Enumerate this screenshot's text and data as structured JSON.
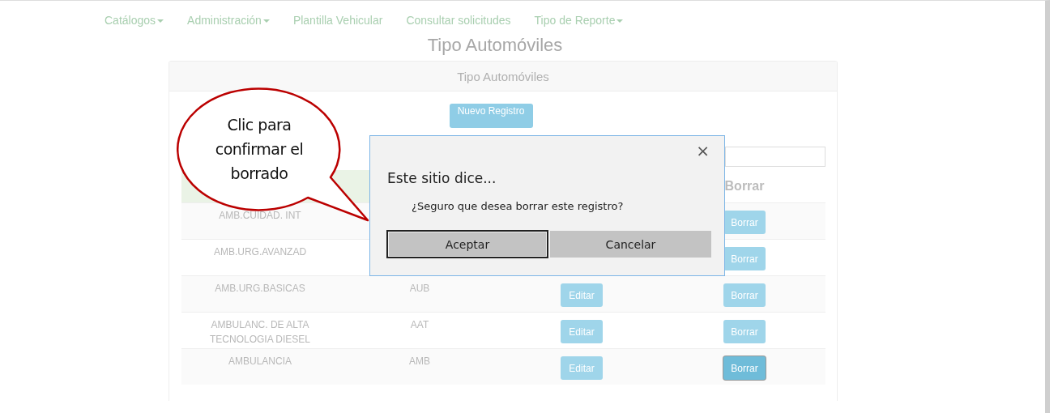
{
  "nav": [
    {
      "label": "Catálogos",
      "dropdown": true
    },
    {
      "label": "Administración",
      "dropdown": true
    },
    {
      "label": "Plantilla Vehicular",
      "dropdown": false
    },
    {
      "label": "Consultar solicitudes",
      "dropdown": false
    },
    {
      "label": "Tipo de Reporte",
      "dropdown": true
    }
  ],
  "page_title": "Tipo Automóviles",
  "panel": {
    "title": "Tipo Automóviles",
    "new_button": "Nuevo Registro",
    "table": {
      "columns": [
        "",
        "",
        "",
        "Borrar"
      ],
      "rows": [
        {
          "description": "AMB.CUIDAD. INT",
          "code": "",
          "edit": "",
          "delete": "Borrar",
          "delete_focused": false
        },
        {
          "description": "AMB.URG.AVANZAD",
          "code": "",
          "edit": "",
          "delete": "Borrar",
          "delete_focused": false
        },
        {
          "description": "AMB.URG.BASICAS",
          "code": "AUB",
          "edit": "Editar",
          "delete": "Borrar",
          "delete_focused": false
        },
        {
          "description": "AMBULANC. DE ALTA TECNOLOGIA DIESEL",
          "code": "AAT",
          "edit": "Editar",
          "delete": "Borrar",
          "delete_focused": false
        },
        {
          "description": "AMBULANCIA",
          "code": "AMB",
          "edit": "Editar",
          "delete": "Borrar",
          "delete_focused": true
        }
      ]
    }
  },
  "dialog": {
    "close": "×",
    "title": "Este sitio dice...",
    "message": "¿Seguro que desea borrar este registro?",
    "buttons": [
      {
        "label": "Aceptar",
        "focused": true
      },
      {
        "label": "Cancelar",
        "focused": false
      }
    ]
  },
  "callout": {
    "text": "Clic para confirmar el borrado"
  }
}
